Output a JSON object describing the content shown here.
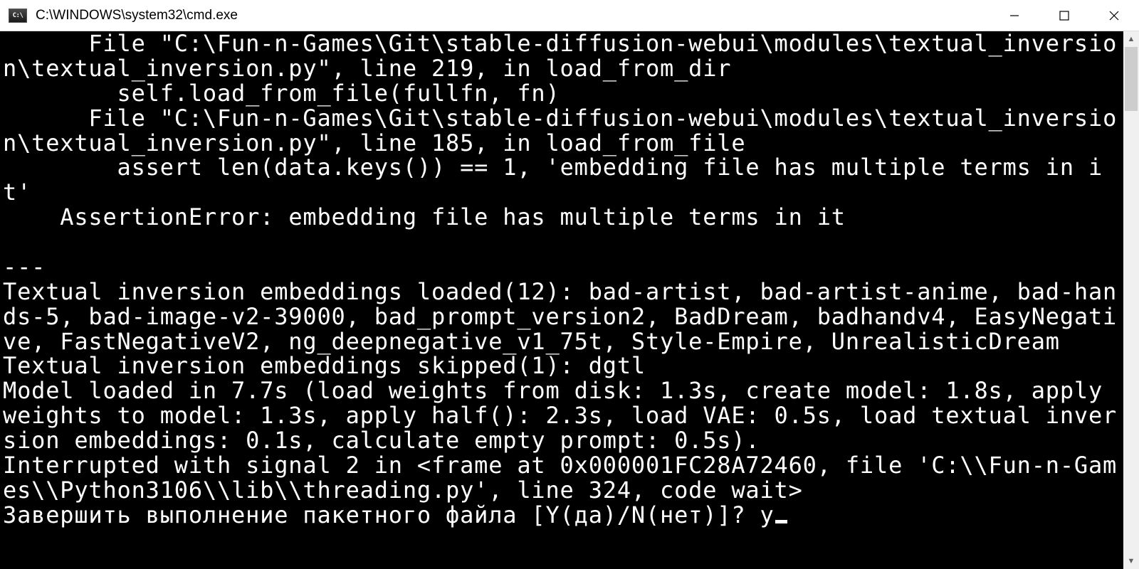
{
  "window": {
    "title": "C:\\WINDOWS\\system32\\cmd.exe"
  },
  "terminal": {
    "lines": [
      "      File \"C:\\Fun-n-Games\\Git\\stable-diffusion-webui\\modules\\textual_inversion\\textual_inversion.py\", line 219, in load_from_dir",
      "        self.load_from_file(fullfn, fn)",
      "      File \"C:\\Fun-n-Games\\Git\\stable-diffusion-webui\\modules\\textual_inversion\\textual_inversion.py\", line 185, in load_from_file",
      "        assert len(data.keys()) == 1, 'embedding file has multiple terms in it'",
      "    AssertionError: embedding file has multiple terms in it",
      "",
      "---",
      "Textual inversion embeddings loaded(12): bad-artist, bad-artist-anime, bad-hands-5, bad-image-v2-39000, bad_prompt_version2, BadDream, badhandv4, EasyNegative, FastNegativeV2, ng_deepnegative_v1_75t, Style-Empire, UnrealisticDream",
      "Textual inversion embeddings skipped(1): dgtl",
      "Model loaded in 7.7s (load weights from disk: 1.3s, create model: 1.8s, apply weights to model: 1.3s, apply half(): 2.3s, load VAE: 0.5s, load textual inversion embeddings: 0.1s, calculate empty prompt: 0.5s).",
      "Interrupted with signal 2 in <frame at 0x000001FC28A72460, file 'C:\\\\Fun-n-Games\\\\Python3106\\\\lib\\\\threading.py', line 324, code wait>"
    ],
    "prompt": "Завершить выполнение пакетного файла [Y(да)/N(нет)]? ",
    "input": "y"
  }
}
